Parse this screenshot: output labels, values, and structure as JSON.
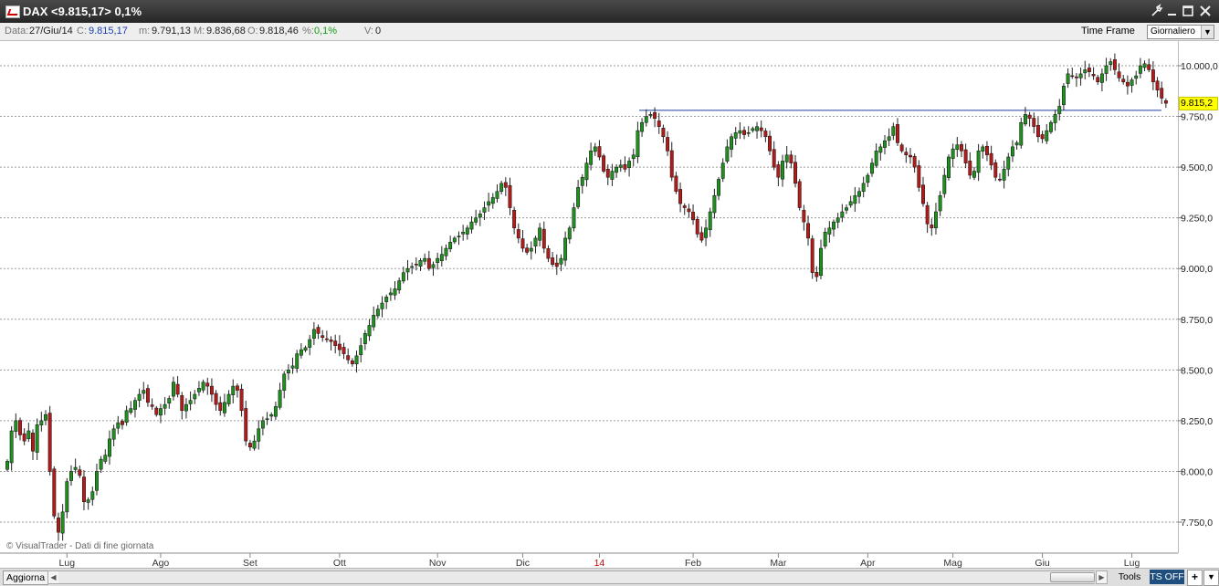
{
  "window": {
    "title": "DAX <9.815,17> 0,1%",
    "tool_icon": "wrench-icon",
    "min_icon": "minimize-icon",
    "max_icon": "maximize-icon",
    "close_icon": "close-icon"
  },
  "info": {
    "date_label": "Data:",
    "date_value": "27/Giu/14",
    "close_label": "C:",
    "close_value": "9.815,17",
    "min_label": "m:",
    "min_value": "9.791,13",
    "max_label": "M:",
    "max_value": "9.836,68",
    "open_label": "O:",
    "open_value": "9.818,46",
    "pct_label": "%:",
    "pct_value": "0,1%",
    "vol_label": "V:",
    "vol_value": "0",
    "timeframe_label": "Time Frame",
    "timeframe_value": "Giornaliero"
  },
  "credit": "© VisualTrader - Dati di fine giornata",
  "bottom": {
    "refresh_label": "Aggiorna",
    "tools_label": "Tools",
    "ts_label": "TS OFF",
    "plus_label": "+"
  },
  "chart_data": {
    "type": "candlestick",
    "symbol": "DAX",
    "last_price_label": "9.815,2",
    "ylim": [
      7650,
      10100
    ],
    "y_ticks": [
      {
        "value": 7750,
        "label": "7.750,0"
      },
      {
        "value": 8000,
        "label": "8.000,0"
      },
      {
        "value": 8250,
        "label": "8.250,0"
      },
      {
        "value": 8500,
        "label": "8.500,0"
      },
      {
        "value": 8750,
        "label": "8.750,0"
      },
      {
        "value": 9000,
        "label": "9.000,0"
      },
      {
        "value": 9250,
        "label": "9.250,0"
      },
      {
        "value": 9500,
        "label": "9.500,0"
      },
      {
        "value": 9750,
        "label": "9.750,0"
      },
      {
        "value": 10000,
        "label": "10.000,0"
      }
    ],
    "x_ticks": [
      {
        "bar": 14,
        "label": "Lug",
        "color": "#333333"
      },
      {
        "bar": 36,
        "label": "Ago",
        "color": "#333333"
      },
      {
        "bar": 57,
        "label": "Set",
        "color": "#333333"
      },
      {
        "bar": 78,
        "label": "Ott",
        "color": "#333333"
      },
      {
        "bar": 101,
        "label": "Nov",
        "color": "#333333"
      },
      {
        "bar": 121,
        "label": "Dic",
        "color": "#333333"
      },
      {
        "bar": 139,
        "label": "14",
        "color": "#cc0000"
      },
      {
        "bar": 161,
        "label": "Feb",
        "color": "#333333"
      },
      {
        "bar": 181,
        "label": "Mar",
        "color": "#333333"
      },
      {
        "bar": 202,
        "label": "Apr",
        "color": "#333333"
      },
      {
        "bar": 222,
        "label": "Mag",
        "color": "#333333"
      },
      {
        "bar": 243,
        "label": "Giu",
        "color": "#333333"
      },
      {
        "bar": 264,
        "label": "Lug",
        "color": "#333333"
      }
    ],
    "closes": [
      8050,
      8200,
      8250,
      8180,
      8150,
      8200,
      8100,
      8230,
      8250,
      8280,
      8000,
      7780,
      7700,
      7800,
      7950,
      8000,
      8020,
      7980,
      7850,
      7860,
      7900,
      8000,
      8060,
      8080,
      8160,
      8210,
      8240,
      8230,
      8300,
      8310,
      8350,
      8380,
      8400,
      8340,
      8320,
      8280,
      8310,
      8330,
      8360,
      8440,
      8380,
      8300,
      8330,
      8350,
      8380,
      8410,
      8440,
      8420,
      8380,
      8330,
      8300,
      8340,
      8380,
      8420,
      8400,
      8300,
      8150,
      8120,
      8150,
      8210,
      8250,
      8260,
      8280,
      8320,
      8400,
      8480,
      8500,
      8520,
      8580,
      8600,
      8610,
      8650,
      8700,
      8680,
      8660,
      8650,
      8640,
      8620,
      8600,
      8580,
      8550,
      8530,
      8570,
      8620,
      8680,
      8720,
      8770,
      8800,
      8830,
      8860,
      8880,
      8900,
      8940,
      8980,
      9000,
      9010,
      9020,
      9040,
      9050,
      9000,
      9020,
      9050,
      9070,
      9100,
      9130,
      9150,
      9160,
      9180,
      9200,
      9230,
      9250,
      9270,
      9300,
      9330,
      9350,
      9380,
      9420,
      9400,
      9300,
      9200,
      9150,
      9100,
      9080,
      9100,
      9150,
      9200,
      9100,
      9050,
      9020,
      9010,
      9050,
      9150,
      9200,
      9300,
      9400,
      9450,
      9520,
      9580,
      9600,
      9550,
      9480,
      9450,
      9480,
      9500,
      9510,
      9490,
      9530,
      9560,
      9680,
      9720,
      9750,
      9760,
      9740,
      9700,
      9650,
      9580,
      9450,
      9380,
      9320,
      9300,
      9280,
      9240,
      9170,
      9140,
      9200,
      9280,
      9360,
      9440,
      9520,
      9600,
      9650,
      9670,
      9680,
      9660,
      9670,
      9690,
      9700,
      9680,
      9650,
      9580,
      9500,
      9450,
      9530,
      9560,
      9520,
      9420,
      9300,
      9230,
      9150,
      8980,
      8960,
      9100,
      9180,
      9200,
      9230,
      9250,
      9280,
      9300,
      9330,
      9360,
      9380,
      9420,
      9460,
      9520,
      9580,
      9600,
      9630,
      9650,
      9700,
      9620,
      9580,
      9560,
      9550,
      9500,
      9400,
      9320,
      9220,
      9200,
      9280,
      9360,
      9460,
      9550,
      9590,
      9610,
      9580,
      9520,
      9460,
      9480,
      9580,
      9600,
      9560,
      9510,
      9450,
      9440,
      9490,
      9550,
      9600,
      9620,
      9720,
      9760,
      9740,
      9700,
      9650,
      9640,
      9680,
      9720,
      9760,
      9800,
      9900,
      9960,
      9950,
      9940,
      9960,
      9980,
      9970,
      9950,
      9920,
      9960,
      10000,
      10020,
      9980,
      9940,
      9920,
      9900,
      9930,
      9950,
      10000,
      10010,
      9980,
      9920,
      9880,
      9840,
      9815
    ]
  }
}
